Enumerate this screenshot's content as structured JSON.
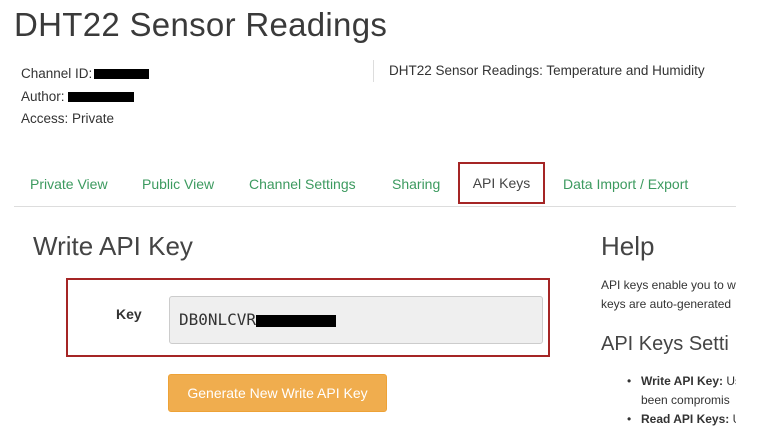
{
  "header": {
    "title": "DHT22 Sensor Readings"
  },
  "channel": {
    "id_label": "Channel ID:",
    "author_label": "Author:",
    "access": "Access: Private",
    "description": "DHT22 Sensor Readings: Temperature and Humidity"
  },
  "tabs": [
    {
      "label": "Private View"
    },
    {
      "label": "Public View"
    },
    {
      "label": "Channel Settings"
    },
    {
      "label": "Sharing"
    },
    {
      "label": "API Keys",
      "active": true
    },
    {
      "label": "Data Import / Export"
    }
  ],
  "write_key": {
    "title": "Write API Key",
    "label": "Key",
    "value_visible": "DB0NLCVR",
    "generate_label": "Generate New Write API Key"
  },
  "help": {
    "title": "Help",
    "line1": "API keys enable you to w",
    "line2": "keys are auto-generated",
    "subtitle": "API Keys Setti",
    "item1_bold": "Write API Key:",
    "item1_text": " Us",
    "item1_cont": "been compromis",
    "item2_bold": "Read API Keys:",
    "item2_text": " U"
  },
  "colors": {
    "tab_link": "#3c9a5f",
    "highlight": "#a52525",
    "button": "#f0ad4e"
  }
}
